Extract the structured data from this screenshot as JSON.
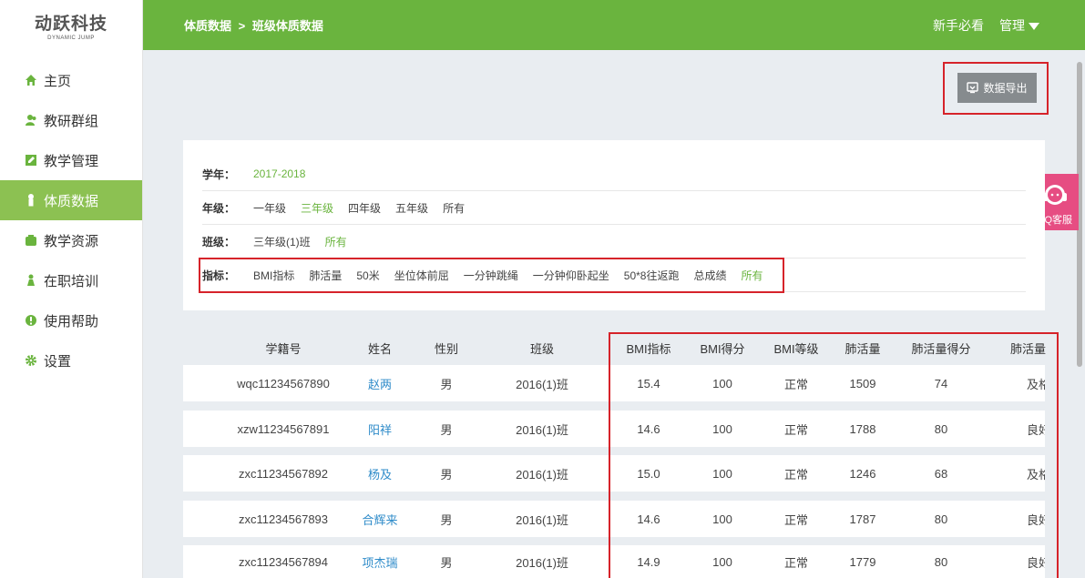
{
  "sidebar": {
    "brand": "动跃科技",
    "brand_sub": "DYNAMIC JUMP",
    "items": [
      {
        "label": "主页",
        "icon": "home-icon"
      },
      {
        "label": "教研群组",
        "icon": "users-icon"
      },
      {
        "label": "教学管理",
        "icon": "edit-icon"
      },
      {
        "label": "体质数据",
        "icon": "person-icon",
        "active": true
      },
      {
        "label": "教学资源",
        "icon": "box-icon"
      },
      {
        "label": "在职培训",
        "icon": "person-icon"
      },
      {
        "label": "使用帮助",
        "icon": "help-icon"
      },
      {
        "label": "设置",
        "icon": "gear-icon"
      }
    ]
  },
  "topbar": {
    "crumb_parent": "体质数据",
    "crumb_sep": ">",
    "crumb_current": "班级体质数据",
    "newbie": "新手必看",
    "manage": "管理"
  },
  "export_label": "数据导出",
  "qq_label": "QQ客服",
  "filters": {
    "year": {
      "label": "学年：",
      "options": [
        "2017-2018"
      ],
      "selected": 0
    },
    "grade": {
      "label": "年级：",
      "options": [
        "一年级",
        "三年级",
        "四年级",
        "五年级",
        "所有"
      ],
      "selected": 1
    },
    "class": {
      "label": "班级：",
      "options": [
        "三年级(1)班",
        "所有"
      ],
      "selected": 1
    },
    "indicator": {
      "label": "指标：",
      "options": [
        "BMI指标",
        "肺活量",
        "50米",
        "坐位体前屈",
        "一分钟跳绳",
        "一分钟仰卧起坐",
        "50*8往返跑",
        "总成绩",
        "所有"
      ],
      "selected": 8
    }
  },
  "table": {
    "headers": [
      "学籍号",
      "姓名",
      "性别",
      "班级",
      "BMI指标",
      "BMI得分",
      "BMI等级",
      "肺活量",
      "肺活量得分",
      "肺活量"
    ],
    "rows": [
      [
        "wqc11234567890",
        "赵两",
        "男",
        "2016(1)班",
        "15.4",
        "100",
        "正常",
        "1509",
        "74",
        "及格"
      ],
      [
        "xzw11234567891",
        "阳祥",
        "男",
        "2016(1)班",
        "14.6",
        "100",
        "正常",
        "1788",
        "80",
        "良好"
      ],
      [
        "zxc11234567892",
        "杨及",
        "男",
        "2016(1)班",
        "15.0",
        "100",
        "正常",
        "1246",
        "68",
        "及格"
      ],
      [
        "zxc11234567893",
        "合辉来",
        "男",
        "2016(1)班",
        "14.6",
        "100",
        "正常",
        "1787",
        "80",
        "良好"
      ],
      [
        "zxc11234567894",
        "项杰瑞",
        "男",
        "2016(1)班",
        "14.9",
        "100",
        "正常",
        "1779",
        "80",
        "良好"
      ]
    ]
  },
  "colors": {
    "accent": "#6ab43e",
    "active_nav": "#8cc152",
    "highlight": "#d6232a",
    "link": "#2e8bc9",
    "qq": "#e64d82"
  }
}
